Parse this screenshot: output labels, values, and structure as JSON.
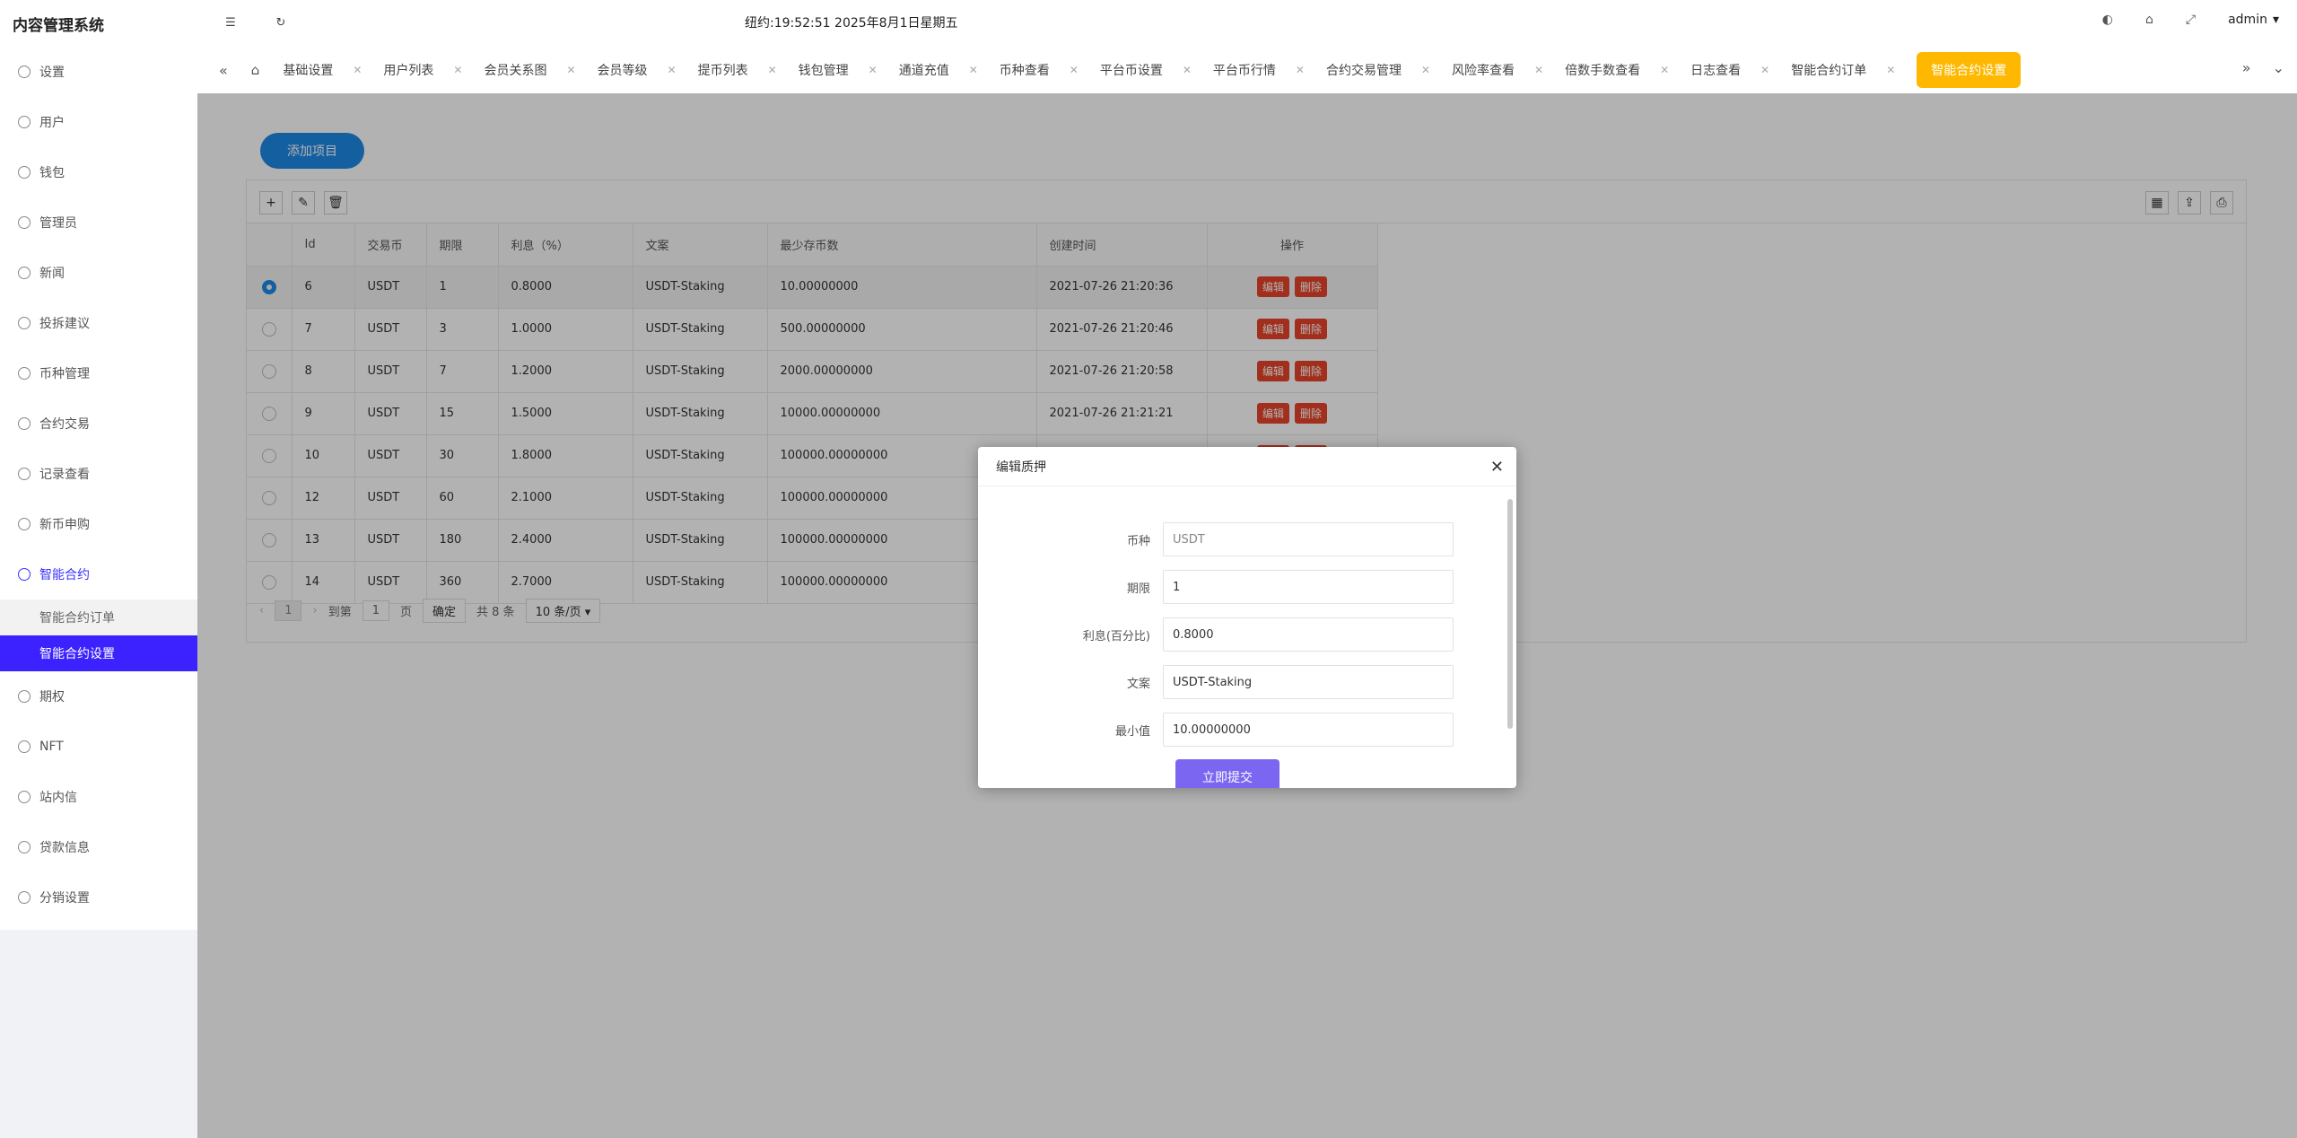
{
  "app": {
    "title": "内容管理系统"
  },
  "header": {
    "clock": "纽约:19:52:51 2025年8月1日星期五",
    "user": "admin"
  },
  "sidebar": {
    "items": [
      {
        "label": "设置",
        "icon": "gear-icon"
      },
      {
        "label": "用户",
        "icon": "user-icon"
      },
      {
        "label": "钱包",
        "icon": "wallet-icon"
      },
      {
        "label": "管理员",
        "icon": "shield-icon"
      },
      {
        "label": "新闻",
        "icon": "tag-icon"
      },
      {
        "label": "投拆建议",
        "icon": "feedback-icon"
      },
      {
        "label": "币种管理",
        "icon": "diamond-icon"
      },
      {
        "label": "合约交易",
        "icon": "diamond-icon"
      },
      {
        "label": "记录查看",
        "icon": "record-icon"
      },
      {
        "label": "新币申购",
        "icon": "coin-icon"
      },
      {
        "label": "智能合约",
        "icon": "contract-icon"
      }
    ],
    "sub": [
      {
        "label": "智能合约订单"
      },
      {
        "label": "智能合约设置"
      }
    ],
    "items_after": [
      {
        "label": "期权",
        "icon": "option-icon"
      },
      {
        "label": "NFT",
        "icon": "nft-icon"
      },
      {
        "label": "站内信",
        "icon": "bell-icon"
      },
      {
        "label": "贷款信息",
        "icon": "loan-icon"
      },
      {
        "label": "分销设置",
        "icon": "gear-icon"
      }
    ]
  },
  "tabs": [
    "基础设置",
    "用户列表",
    "会员关系图",
    "会员等级",
    "提币列表",
    "钱包管理",
    "通道充值",
    "币种查看",
    "平台币设置",
    "平台币行情",
    "合约交易管理",
    "风险率查看",
    "倍数手数查看",
    "日志查看",
    "智能合约订单",
    "智能合约设置"
  ],
  "main": {
    "add_button": "添加项目",
    "table": {
      "headers": [
        "Id",
        "交易币",
        "期限",
        "利息（%）",
        "文案",
        "最少存币数",
        "创建时间",
        "操作"
      ],
      "rows": [
        [
          "6",
          "USDT",
          "1",
          "0.8000",
          "USDT-Staking",
          "10.00000000",
          "2021-07-26 21:20:36"
        ],
        [
          "7",
          "USDT",
          "3",
          "1.0000",
          "USDT-Staking",
          "500.00000000",
          "2021-07-26 21:20:46"
        ],
        [
          "8",
          "USDT",
          "7",
          "1.2000",
          "USDT-Staking",
          "2000.00000000",
          "2021-07-26 21:20:58"
        ],
        [
          "9",
          "USDT",
          "15",
          "1.5000",
          "USDT-Staking",
          "10000.00000000",
          "2021-07-26 21:21:21"
        ],
        [
          "10",
          "USDT",
          "30",
          "1.8000",
          "USDT-Staking",
          "100000.00000000",
          ""
        ],
        [
          "12",
          "USDT",
          "60",
          "2.1000",
          "USDT-Staking",
          "100000.00000000",
          ""
        ],
        [
          "13",
          "USDT",
          "180",
          "2.4000",
          "USDT-Staking",
          "100000.00000000",
          ""
        ],
        [
          "14",
          "USDT",
          "360",
          "2.7000",
          "USDT-Staking",
          "100000.00000000",
          ""
        ]
      ],
      "row_actions": [
        "编辑",
        "删除"
      ]
    },
    "pager": {
      "current": "1",
      "goto_label": "到第",
      "goto_value": "1",
      "page_unit": "页",
      "confirm": "确定",
      "total": "共 8 条",
      "page_size": "10 条/页"
    }
  },
  "modal": {
    "title": "编辑质押",
    "fields": [
      {
        "label": "币种",
        "value": "USDT"
      },
      {
        "label": "期限",
        "value": "1"
      },
      {
        "label": "利息(百分比)",
        "value": "0.8000"
      },
      {
        "label": "文案",
        "value": "USDT-Staking"
      },
      {
        "label": "最小值",
        "value": "10.00000000"
      }
    ],
    "submit": "立即提交"
  },
  "colors": {
    "accent": "#3b22ff",
    "tab_active": "#ffb800",
    "primary": "#1e88e5",
    "danger": "#e8442a",
    "submit": "#7a66f0"
  }
}
